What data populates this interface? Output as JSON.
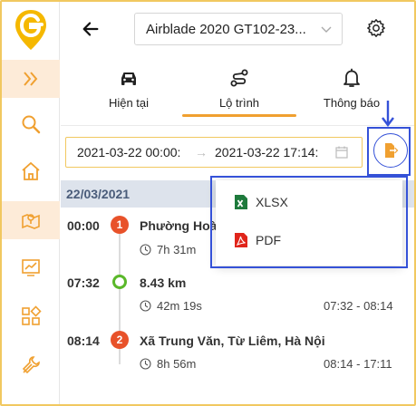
{
  "vehicle": {
    "selected": "Airblade 2020 GT102-23..."
  },
  "tabs": [
    {
      "label": "Hiện tại",
      "icon": "car-icon"
    },
    {
      "label": "Lộ trình",
      "icon": "route-icon",
      "active": true
    },
    {
      "label": "Thông báo",
      "icon": "bell-icon"
    }
  ],
  "date_range": {
    "from": "2021-03-22 00:00:",
    "to": "2021-03-22 17:14:"
  },
  "export_menu": {
    "items": [
      {
        "label": "XLSX",
        "icon": "excel-icon"
      },
      {
        "label": "PDF",
        "icon": "pdf-icon"
      }
    ]
  },
  "day": {
    "label": "22/03/2021"
  },
  "timeline": [
    {
      "time": "00:00",
      "badge": "1",
      "title": "Phường Hoà",
      "duration": "7h 31m",
      "range": ""
    },
    {
      "time": "07:32",
      "title": "8.43 km",
      "duration": "42m 19s",
      "range": "07:32 - 08:14"
    },
    {
      "time": "08:14",
      "badge": "2",
      "title": "Xã Trung Văn, Từ Liêm, Hà Nội",
      "duration": "8h 56m",
      "range": "08:14 - 17:11"
    }
  ],
  "colors": {
    "accent": "#f0a030",
    "highlight": "#3552d8",
    "stop_badge": "#e8522a",
    "move_dot": "#5ab82a"
  }
}
